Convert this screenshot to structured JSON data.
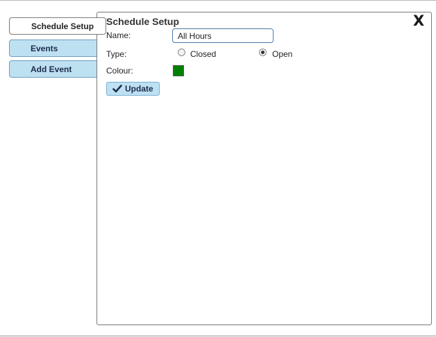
{
  "tabs": [
    {
      "label": "Schedule Setup",
      "active": true
    },
    {
      "label": "Events",
      "active": false
    },
    {
      "label": "Add Event",
      "active": false
    }
  ],
  "panel": {
    "title": "Schedule Setup",
    "close_label": "X",
    "name_label": "Name:",
    "name_value": "All Hours",
    "type_label": "Type:",
    "type_options": [
      "Closed",
      "Open"
    ],
    "type_selected": "Open",
    "colour_label": "Colour:",
    "colour_value": "#008000",
    "update_label": "Update",
    "update_icon": "check-icon"
  },
  "colors": {
    "tab_inactive_bg": "#bee1f2",
    "input_border": "#4a7aa5"
  }
}
